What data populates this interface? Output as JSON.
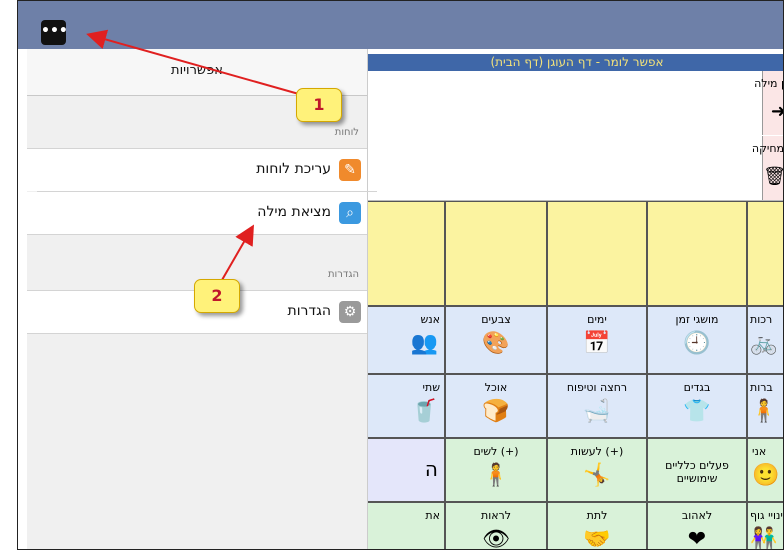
{
  "topbar": {
    "menu_icon": "more-icon",
    "menu_glyph": "•••"
  },
  "panel": {
    "title": "אפשרויות",
    "section_boards": "לוחות",
    "edit_boards": "עריכת לוחות",
    "find_word": "מציאת מילה",
    "section_settings": "הגדרות",
    "settings": "הגדרות",
    "edit_icon": "pencil-icon",
    "search_icon": "search-icon",
    "settings_icon": "gear-icon"
  },
  "board": {
    "title": "אפשר לומר - דף העוגן (דף הבית)",
    "side_top_label": "ן מילה",
    "side_bottom_label": "מחיקה",
    "row1": [
      "צבעים",
      "ימים",
      "מושגי זמן",
      "רכות"
    ],
    "row1_partial": "אנש",
    "row2": [
      "אוכל",
      "רחצה וטיפוח",
      "בגדים",
      "ברות"
    ],
    "row2_partial": "שתי",
    "row3": [
      "לשים (+)",
      "לעשות (+)",
      "פעלים כלליים שימושיים",
      "אני"
    ],
    "row3_partial": "ה",
    "row4": [
      "לראות",
      "לתת",
      "לאהוב",
      "ינויי גוף"
    ],
    "row4_partial": "את"
  },
  "callouts": {
    "one": "1",
    "two": "2"
  },
  "colors": {
    "topbar": "#6e80a8",
    "title_bar": "#3f67a8",
    "callout": "#fff27a",
    "arrow": "#e02020"
  }
}
